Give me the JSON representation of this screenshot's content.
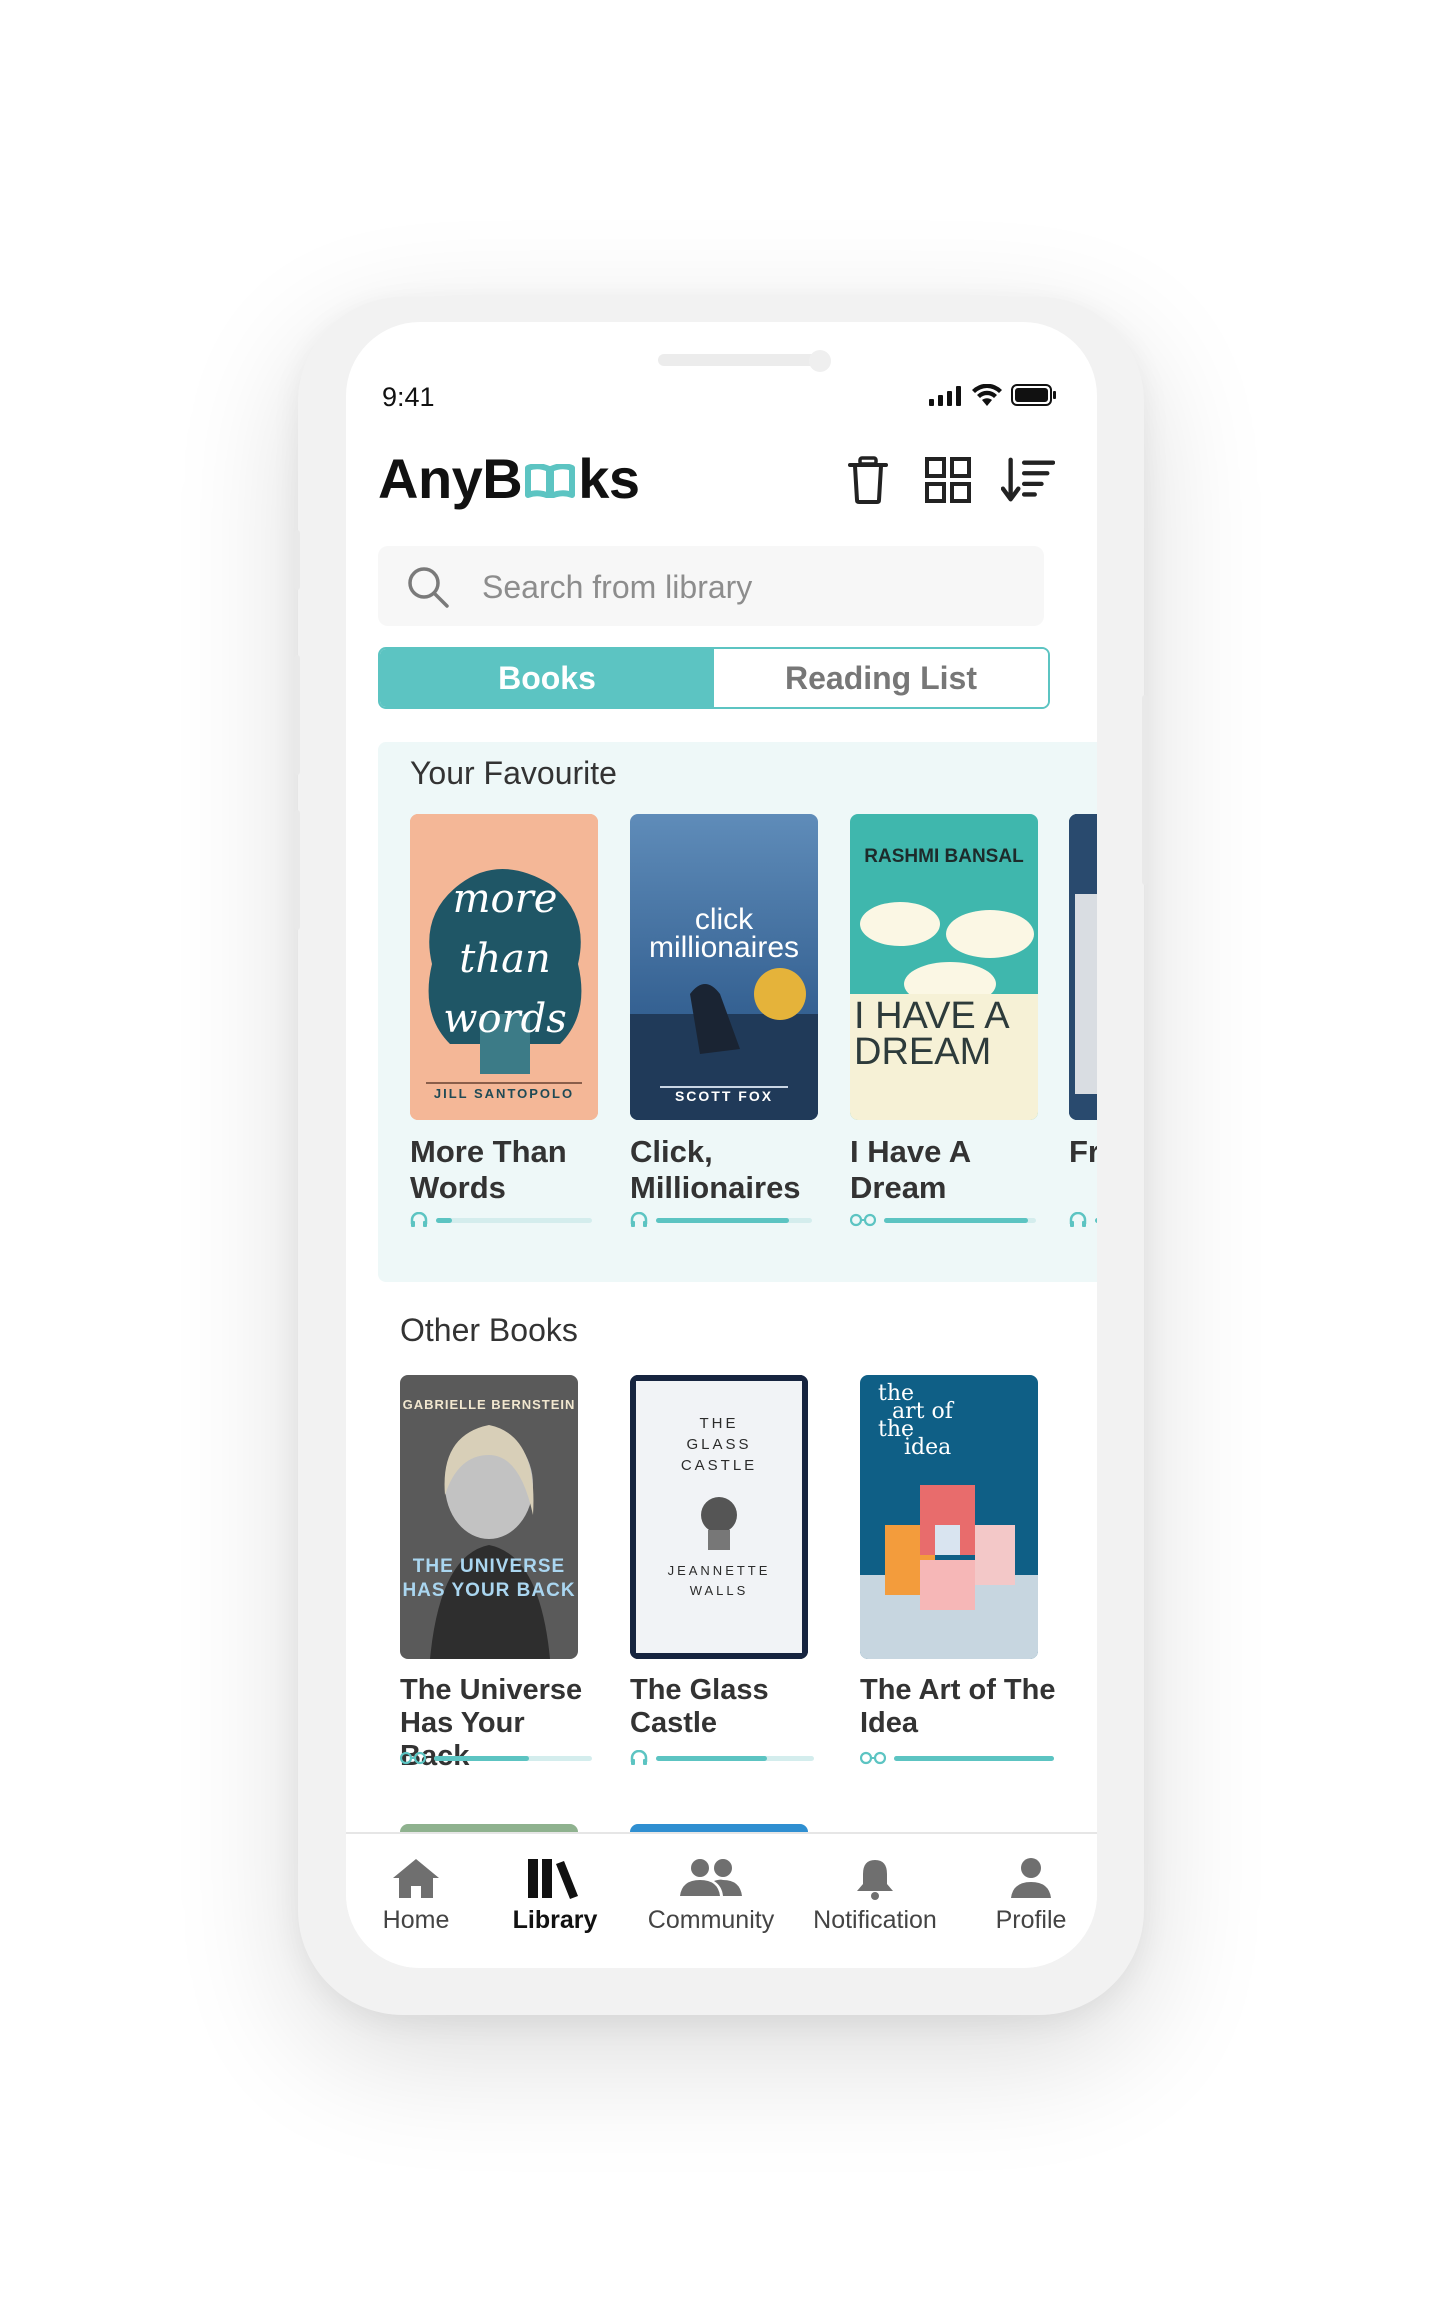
{
  "status_bar": {
    "time": "9:41"
  },
  "header": {
    "title_start": "AnyB",
    "title_end": "ks",
    "logo_icon": "open-book-icon"
  },
  "toolbar": {
    "delete_icon": "trash-icon",
    "grid_icon": "grid-view-icon",
    "sort_icon": "sort-icon"
  },
  "search": {
    "placeholder": "Search from library",
    "value": ""
  },
  "tabs": [
    {
      "label": "Books",
      "active": true
    },
    {
      "label": "Reading List",
      "active": false
    }
  ],
  "favourites": {
    "title": "Your Favourite",
    "books": [
      {
        "title": "More Than Words",
        "format_icon": "headphones-icon",
        "progress": 0.1,
        "cover_text": [
          "more",
          "than",
          "words"
        ],
        "cover_author": "JILL SANTOPOLO"
      },
      {
        "title": "Click, Millionaires",
        "format_icon": "headphones-icon",
        "progress": 0.85,
        "cover_text": [
          "click",
          "millionaires"
        ],
        "cover_author": "SCOTT FOX"
      },
      {
        "title": "I Have A Dream",
        "format_icon": "reading-glasses-icon",
        "progress": 0.95,
        "cover_text": [
          "I HAVE A",
          "DREAM"
        ],
        "cover_author": "RASHMI BANSAL"
      },
      {
        "title": "Fr",
        "format_icon": "headphones-icon",
        "progress": 0.3
      }
    ]
  },
  "other_books": {
    "title": "Other Books",
    "books": [
      {
        "title": "The Universe Has Your Back",
        "format_icon": "reading-glasses-icon",
        "progress": 0.6,
        "cover_text": [
          "THE UNIVERSE",
          "HAS YOUR BACK"
        ],
        "cover_author": "GABRIELLE BERNSTEIN"
      },
      {
        "title": "The Glass Castle",
        "format_icon": "headphones-icon",
        "progress": 0.7,
        "cover_text": [
          "THE",
          "GLASS",
          "CASTLE"
        ],
        "cover_author": "JEANNETTE WALLS"
      },
      {
        "title": "The Art of The Idea",
        "format_icon": "reading-glasses-icon",
        "progress": 1.0,
        "cover_text": [
          "the",
          "art of",
          "the",
          "idea"
        ]
      }
    ]
  },
  "bottom_nav": [
    {
      "label": "Home",
      "icon": "home-icon",
      "active": false
    },
    {
      "label": "Library",
      "icon": "library-icon",
      "active": true
    },
    {
      "label": "Community",
      "icon": "community-icon",
      "active": false
    },
    {
      "label": "Notification",
      "icon": "bell-icon",
      "active": false
    },
    {
      "label": "Profile",
      "icon": "profile-icon",
      "active": false
    }
  ],
  "colors": {
    "accent": "#5cc4c2",
    "panel": "#eef8f8",
    "text": "#333333"
  }
}
